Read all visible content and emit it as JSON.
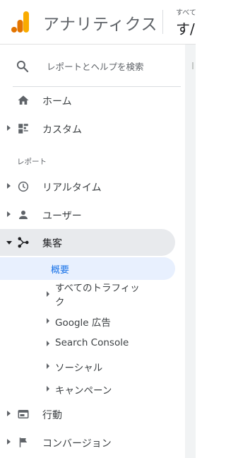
{
  "header": {
    "app_title": "アナリティクス",
    "account_small": "すべて",
    "account_big": "す/",
    "brand_colors": {
      "logo_dark": "#e37400",
      "logo_light": "#f9ab00"
    }
  },
  "search": {
    "placeholder": "レポートとヘルプを検索",
    "icon": "search-icon"
  },
  "nav_top": [
    {
      "label": "ホーム",
      "icon": "home-icon"
    },
    {
      "label": "カスタム",
      "icon": "dashboard-icon"
    }
  ],
  "section": {
    "label": "レポート"
  },
  "reports": [
    {
      "label": "リアルタイム",
      "icon": "clock-icon"
    },
    {
      "label": "ユーザー",
      "icon": "person-icon"
    },
    {
      "label": "集客",
      "icon": "acquisition-icon",
      "expanded": true
    }
  ],
  "acquisition": {
    "overview_label": "概要",
    "children": [
      {
        "label": "すべてのトラフィック"
      },
      {
        "label": "Google 広告"
      },
      {
        "label": "Search Console"
      },
      {
        "label": "ソーシャル"
      },
      {
        "label": "キャンペーン"
      }
    ]
  },
  "reports_after": [
    {
      "label": "行動",
      "icon": "behavior-icon"
    },
    {
      "label": "コンバージョン",
      "icon": "flag-icon"
    }
  ],
  "colors": {
    "accent": "#1a73e8",
    "selected_bg": "#e8f0fe",
    "active_bg": "#e8eaed"
  }
}
